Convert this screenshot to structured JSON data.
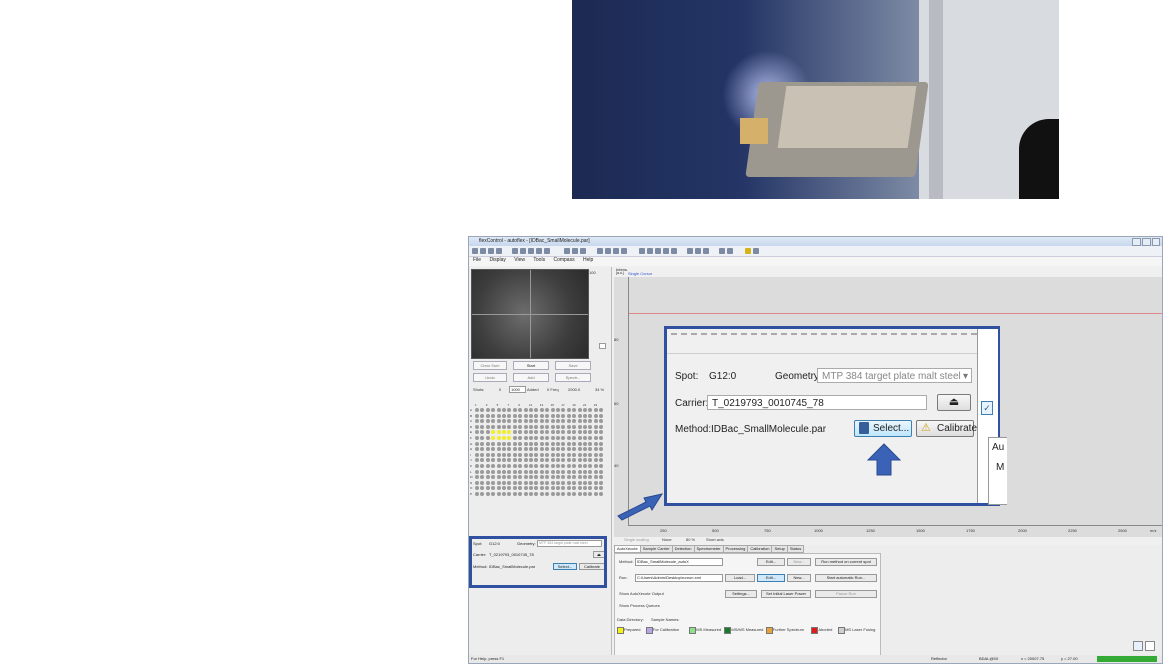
{
  "window": {
    "title": "flexControl - autoflex - [IDBac_SmallMolecule.par]",
    "menus": [
      "File",
      "Display",
      "View",
      "Tools",
      "Compass",
      "Help"
    ]
  },
  "left_panel": {
    "scale_value": "100",
    "buttons": {
      "clear_sum": "Clear Sum",
      "start": "Start",
      "save": "Save",
      "undo": "Undo",
      "add": "Add",
      "spectra": "Spectr..."
    },
    "shots_label": "Shots:",
    "shots_value": "0",
    "shots_total": "1000",
    "added_label": "Added",
    "freq_label": "0 Freq",
    "freq_value": "2000.0",
    "percent": "34 %",
    "spot_column_labels": [
      "1",
      "2",
      "3",
      "4",
      "5",
      "6",
      "7",
      "8",
      "9",
      "10",
      "11",
      "12",
      "13",
      "14",
      "15",
      "16",
      "17",
      "18",
      "19",
      "20",
      "21",
      "22",
      "23",
      "24"
    ],
    "spot_row_labels": [
      "A",
      "B",
      "C",
      "D",
      "E",
      "F",
      "G",
      "H",
      "I",
      "J",
      "K",
      "L",
      "M",
      "N",
      "O",
      "P"
    ]
  },
  "spot_info_small": {
    "spot_label": "Spot:",
    "spot_value": "G12:0",
    "geometry_label": "Geometry:",
    "geometry_value": "MTP 384 target plate malt steel",
    "carrier_label": "Carrier:",
    "carrier_value": "T_0219793_0010745_78",
    "method_label": "Method:",
    "method_value": "IDBac_SmallMolecule.par",
    "select_label": "Select...",
    "calibrate_label": "Calibrate"
  },
  "plot": {
    "header": "Intens.",
    "header2": "[a.u.]",
    "toggles": "Single  Cursor",
    "y_ticks": [
      "80",
      "60",
      "40"
    ],
    "x_ticks": [
      "250",
      "500",
      "750",
      "1000",
      "1250",
      "1500",
      "1750",
      "2000",
      "2250",
      "2500"
    ],
    "x_unit": "m/z",
    "options": [
      "Single scaling",
      "None",
      "80 %",
      "Short axis"
    ]
  },
  "bottom_panel": {
    "tabs": [
      "AutoXecute",
      "Sample Carrier",
      "Detection",
      "Spectrometer",
      "Processing",
      "Calibration",
      "Setup",
      "Status"
    ],
    "method_label": "Method:",
    "method_value": "IDBac_SmallMolecule_autoX",
    "run_label": "Run:",
    "run_value": "C:\\Users\\Admin\\Desktop\\runrun.xml",
    "edit1": "Edit...",
    "new1": "New...",
    "run_method": "Run method on current spot",
    "load": "Load...",
    "edit2": "Edit...",
    "new2": "New...",
    "start_auto": "Start automatic Run...",
    "show_autoxecute": "Show AutoXecute Output",
    "settings": "Settings...",
    "set_laser": "Set Initial Laser Power",
    "pause_run": "Pause Run",
    "show_process": "Show Process Queues",
    "data_directory": "Data Directory:",
    "sample_names": "Sample Names:",
    "legend": [
      {
        "label": "Prepared",
        "color": "#f5f016"
      },
      {
        "label": "For Calibration",
        "color": "#b8a6e8"
      },
      {
        "label": "MS Measured",
        "color": "#8fe08a"
      },
      {
        "label": "MS/MS Measured",
        "color": "#1b7a2a"
      },
      {
        "label": "Further Spectrum",
        "color": "#e8a23a"
      },
      {
        "label": "Aborted",
        "color": "#e01b1b"
      },
      {
        "label": "MS Laser Fusing",
        "color": "#cfcfcf"
      }
    ]
  },
  "status_bar": {
    "help": "For Help, press F1",
    "mode": "Reflector",
    "tag": "BDAL@5X",
    "x_readout": "x = 20007.75",
    "y_readout": "y = 27.00"
  },
  "zoom": {
    "spot_label": "Spot:",
    "spot_value": "G12:0",
    "geometry_label": "Geometry:",
    "geometry_value": "MTP 384 target plate malt steel",
    "carrier_label": "Carrier:",
    "carrier_value": "T_0219793_0010745_78",
    "method_label": "Method:",
    "method_value": "IDBac_SmallMolecule.par",
    "select_label": "Select...",
    "calibrate_label": "Calibrate",
    "side_text1": "Au",
    "side_text2": "M"
  }
}
